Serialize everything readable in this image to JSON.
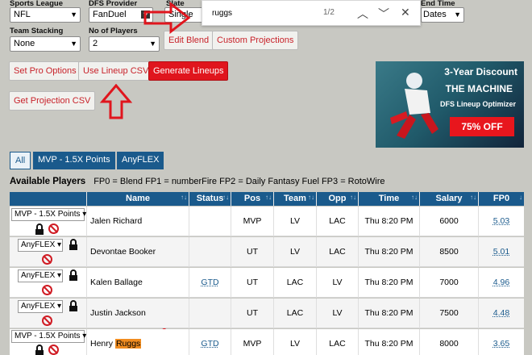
{
  "filters": {
    "sports_league": {
      "label": "Sports League",
      "value": "NFL"
    },
    "dfs_provider": {
      "label": "DFS Provider",
      "value": "FanDuel"
    },
    "slate": {
      "label": "Slate",
      "value": "Single"
    },
    "end_time": {
      "label": "End Time",
      "value": "Dates"
    },
    "team_stacking": {
      "label": "Team Stacking",
      "value": "None"
    },
    "no_of_players": {
      "label": "No of Players",
      "value": "2"
    }
  },
  "buttons": {
    "edit_blend": "Edit Blend",
    "custom_projections": "Custom Projections",
    "set_pro_options": "Set Pro Options",
    "use_lineup_csv": "Use Lineup CSV",
    "generate_lineups": "Generate Lineups",
    "get_projection_csv": "Get Projection CSV"
  },
  "find_bar": {
    "query": "ruggs",
    "count": "1/2"
  },
  "ad": {
    "line1": "3-Year Discount",
    "line2": "THE MACHINE",
    "line3": "DFS Lineup Optimizer",
    "badge": "75% OFF"
  },
  "tabs": [
    "All",
    "MVP - 1.5X Points",
    "AnyFLEX"
  ],
  "available_players": {
    "title": "Available Players",
    "legend": "FP0 = Blend   FP1 = numberFire   FP2 = Daily Fantasy Fuel   FP3 = RotoWire"
  },
  "table": {
    "headers": [
      "Name",
      "Status",
      "Pos",
      "Team",
      "Opp",
      "Time",
      "Salary",
      "FP0"
    ],
    "rows": [
      {
        "slot": "MVP - 1.5X Points",
        "name": "Jalen Richard",
        "status": "",
        "pos": "MVP",
        "team": "LV",
        "opp": "LAC",
        "time": "Thu 8:20 PM",
        "salary": "6000",
        "fp0": "5.03"
      },
      {
        "slot": "AnyFLEX",
        "name": "Devontae Booker",
        "status": "",
        "pos": "UT",
        "team": "LV",
        "opp": "LAC",
        "time": "Thu 8:20 PM",
        "salary": "8500",
        "fp0": "5.01"
      },
      {
        "slot": "AnyFLEX",
        "name": "Kalen Ballage",
        "status": "GTD",
        "pos": "UT",
        "team": "LAC",
        "opp": "LV",
        "time": "Thu 8:20 PM",
        "salary": "7000",
        "fp0": "4.96"
      },
      {
        "slot": "AnyFLEX",
        "name": "Justin Jackson",
        "status": "",
        "pos": "UT",
        "team": "LAC",
        "opp": "LV",
        "time": "Thu 8:20 PM",
        "salary": "7500",
        "fp0": "4.48"
      },
      {
        "slot": "MVP - 1.5X Points",
        "name_first": "Henry",
        "name_last": "Ruggs",
        "status": "GTD",
        "pos": "MVP",
        "team": "LV",
        "opp": "LAC",
        "time": "Thu 8:20 PM",
        "salary": "8000",
        "fp0": "3.65"
      }
    ]
  },
  "colors": {
    "header_blue": "#1a5a8c",
    "accent_red": "#e0151d",
    "highlight_orange": "#f08c20"
  }
}
